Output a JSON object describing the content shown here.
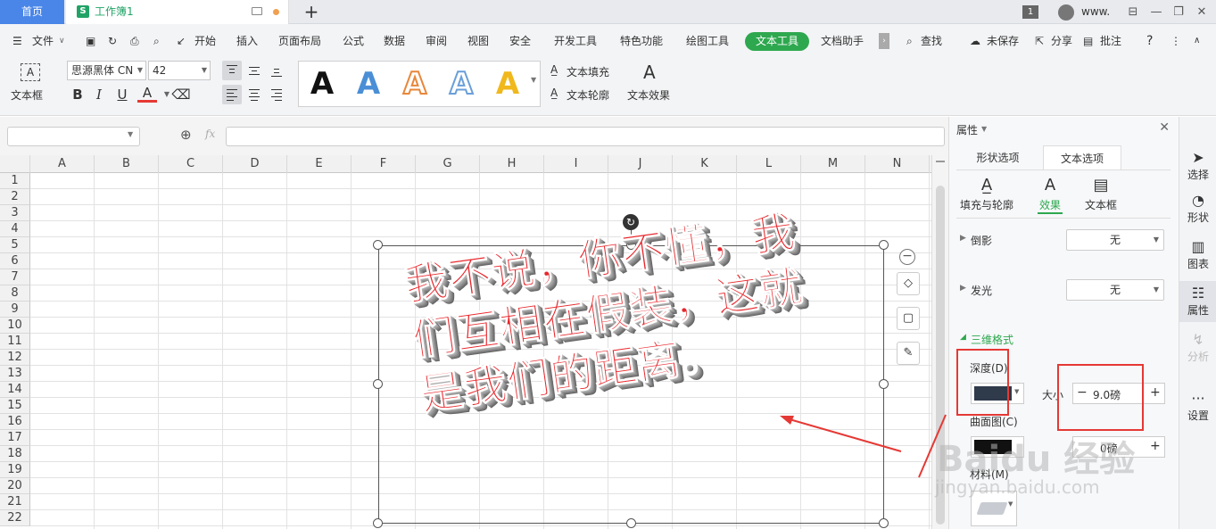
{
  "titlebar": {
    "home_tab": "首页",
    "workbook_tab": "工作簿1",
    "new_tab": "+",
    "window_badge": "1",
    "user_name": "www.",
    "controls": [
      "⊟",
      "—",
      "❐",
      "✕"
    ]
  },
  "menubar": {
    "file": "文件",
    "items": [
      "开始",
      "插入",
      "页面布局",
      "公式",
      "数据",
      "审阅",
      "视图",
      "安全",
      "开发工具",
      "特色功能",
      "绘图工具",
      "文本工具",
      "文档助手"
    ],
    "active": "文本工具",
    "search": "查找",
    "unsaved": "未保存",
    "share": "分享",
    "comment": "批注",
    "help": "?",
    "more": "⋮"
  },
  "ribbon": {
    "textbox_label": "文本框",
    "font_name": "思源黑体 CN",
    "font_size": "42",
    "text_fill": "文本填充",
    "text_outline": "文本轮廓",
    "text_effect": "文本效果",
    "style_letters": [
      "A",
      "A",
      "A",
      "A",
      "A"
    ]
  },
  "formula_bar": {
    "fx": "fx",
    "name_value": "",
    "formula_value": ""
  },
  "sheet": {
    "columns": [
      "A",
      "B",
      "C",
      "D",
      "E",
      "F",
      "G",
      "H",
      "I",
      "J",
      "K",
      "L",
      "M",
      "N"
    ],
    "rows": [
      "1",
      "2",
      "3",
      "4",
      "5",
      "6",
      "7",
      "8",
      "9",
      "10",
      "11",
      "12",
      "13",
      "14",
      "15",
      "16",
      "17",
      "18",
      "19",
      "20",
      "21",
      "22"
    ]
  },
  "textbox": {
    "lines": [
      "我不说，你不懂，我",
      "们互相在假装，这就",
      "是我们的距离。"
    ],
    "fill_color": "#e8262b"
  },
  "properties": {
    "header": "属性",
    "tabs": [
      "形状选项",
      "文本选项"
    ],
    "active_tab": "文本选项",
    "subtabs": [
      "填充与轮廓",
      "效果",
      "文本框"
    ],
    "active_subtab": "效果",
    "reflection_label": "倒影",
    "reflection_value": "无",
    "glow_label": "发光",
    "glow_value": "无",
    "threed_label": "三维格式",
    "depth_label": "深度(D)",
    "depth_color": "#2f3a4a",
    "size_label": "大小",
    "size_value": "9.0磅",
    "contour_label": "曲面图(C)",
    "contour_value": "0磅",
    "material_label": "材料(M)"
  },
  "side_rail": [
    "选择",
    "形状",
    "图表",
    "属性",
    "分析",
    "设置"
  ],
  "watermark": {
    "brand": "Baidu 经验",
    "url": "jingyan.baidu.com"
  }
}
